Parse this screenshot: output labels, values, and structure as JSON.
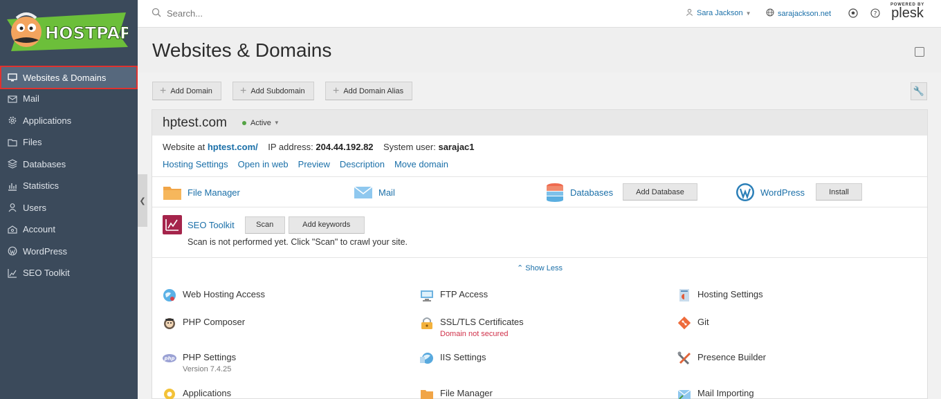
{
  "brand": {
    "logo_text": "HOSTPAPA"
  },
  "sidebar": {
    "items": [
      {
        "label": "Websites & Domains",
        "icon": "monitor-icon",
        "active": true
      },
      {
        "label": "Mail",
        "icon": "mail-icon"
      },
      {
        "label": "Applications",
        "icon": "gear-icon"
      },
      {
        "label": "Files",
        "icon": "folder-icon"
      },
      {
        "label": "Databases",
        "icon": "database-icon"
      },
      {
        "label": "Statistics",
        "icon": "bar-chart-icon"
      },
      {
        "label": "Users",
        "icon": "user-icon"
      },
      {
        "label": "Account",
        "icon": "account-icon"
      },
      {
        "label": "WordPress",
        "icon": "wordpress-icon"
      },
      {
        "label": "SEO Toolkit",
        "icon": "seo-chart-icon"
      }
    ]
  },
  "header": {
    "search_placeholder": "Search...",
    "user_name": "Sara Jackson",
    "site_name": "sarajackson.net",
    "powered_by": "POWERED BY",
    "plesk": "plesk"
  },
  "page": {
    "title": "Websites & Domains",
    "toolbar": {
      "add_domain": "Add Domain",
      "add_subdomain": "Add Subdomain",
      "add_domain_alias": "Add Domain Alias"
    }
  },
  "domain": {
    "name": "hptest.com",
    "status": "Active",
    "website_at_label": "Website at",
    "website_url": "hptest.com/",
    "ip_label": "IP address:",
    "ip": "204.44.192.82",
    "sysuser_label": "System user:",
    "sysuser": "sarajac1",
    "links": [
      "Hosting Settings",
      "Open in web",
      "Preview",
      "Description",
      "Move domain"
    ],
    "quick": {
      "file_manager": "File Manager",
      "mail": "Mail",
      "databases": "Databases",
      "add_database": "Add Database",
      "wordpress": "WordPress",
      "install": "Install"
    },
    "seo": {
      "label": "SEO Toolkit",
      "scan": "Scan",
      "add_keywords": "Add keywords",
      "message": "Scan is not performed yet. Click \"Scan\" to crawl your site."
    },
    "show_less": "Show Less",
    "tools": [
      {
        "label": "Web Hosting Access",
        "icon": "globe-user-icon"
      },
      {
        "label": "FTP Access",
        "icon": "ftp-monitor-icon"
      },
      {
        "label": "Hosting Settings",
        "icon": "hosting-settings-icon"
      },
      {
        "label": "PHP Composer",
        "icon": "composer-icon"
      },
      {
        "label": "SSL/TLS Certificates",
        "icon": "lock-icon",
        "sub": "Domain not secured"
      },
      {
        "label": "Git",
        "icon": "git-icon"
      },
      {
        "label": "PHP Settings",
        "icon": "php-icon",
        "sub": "Version 7.4.25"
      },
      {
        "label": "IIS Settings",
        "icon": "iis-globe-icon"
      },
      {
        "label": "Presence Builder",
        "icon": "tools-icon"
      },
      {
        "label": "Applications",
        "icon": "applications-gear-icon"
      },
      {
        "label": "File Manager",
        "icon": "folder-icon"
      },
      {
        "label": "Mail Importing",
        "icon": "mail-import-icon"
      }
    ]
  }
}
